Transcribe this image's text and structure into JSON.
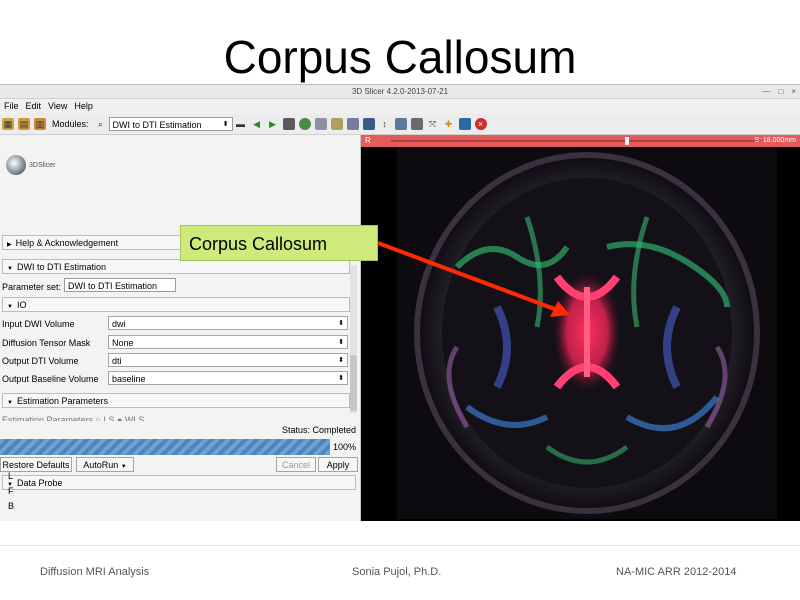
{
  "slide": {
    "title": "Corpus Callosum",
    "callout": "Corpus Callosum",
    "footer": {
      "left": "Diffusion MRI Analysis",
      "center": "Sonia Pujol, Ph.D.",
      "right": "NA-MIC ARR 2012-2014"
    }
  },
  "window": {
    "title": "3D Slicer 4.2.0-2013-07-21",
    "controls": [
      "—",
      "□",
      "×"
    ]
  },
  "menu": [
    "File",
    "Edit",
    "View",
    "Help"
  ],
  "toolbar": {
    "modules_label": "Modules:",
    "module_selected": "DWI to DTI Estimation"
  },
  "logo": {
    "text": "3DSlicer"
  },
  "panel": {
    "help_section": "Help & Acknowledgement",
    "module_section": "DWI to DTI Estimation",
    "parameter_set_label": "Parameter set:",
    "parameter_set_value": "DWI to DTI Estimation",
    "io_section": "IO",
    "io_rows": [
      {
        "label": "Input DWI Volume",
        "value": "dwi"
      },
      {
        "label": "Diffusion Tensor Mask",
        "value": "None"
      },
      {
        "label": "Output DTI Volume",
        "value": "dti"
      },
      {
        "label": "Output Baseline Volume",
        "value": "baseline"
      }
    ],
    "estimation_section": "Estimation Parameters",
    "estimation_row": "Estimation Parameters   ○ LS   ● WLS",
    "status": "Status: Completed",
    "progress": {
      "value": 100,
      "label": "100%"
    },
    "restore_defaults": "Restore Defaults",
    "autorun": "AutoRun",
    "cancel": "Cancel",
    "apply": "Apply",
    "data_probe_section": "Data Probe",
    "probe_labels": [
      "L",
      "F",
      "B"
    ]
  },
  "viewer": {
    "orientation": "R",
    "slice_value": "S: 18.000mm"
  },
  "colors": {
    "slice_bar": "#e35b5b",
    "progress": "#5b91c4",
    "callout_bg": "#cdea7a",
    "arrow": "#ff2a00"
  }
}
